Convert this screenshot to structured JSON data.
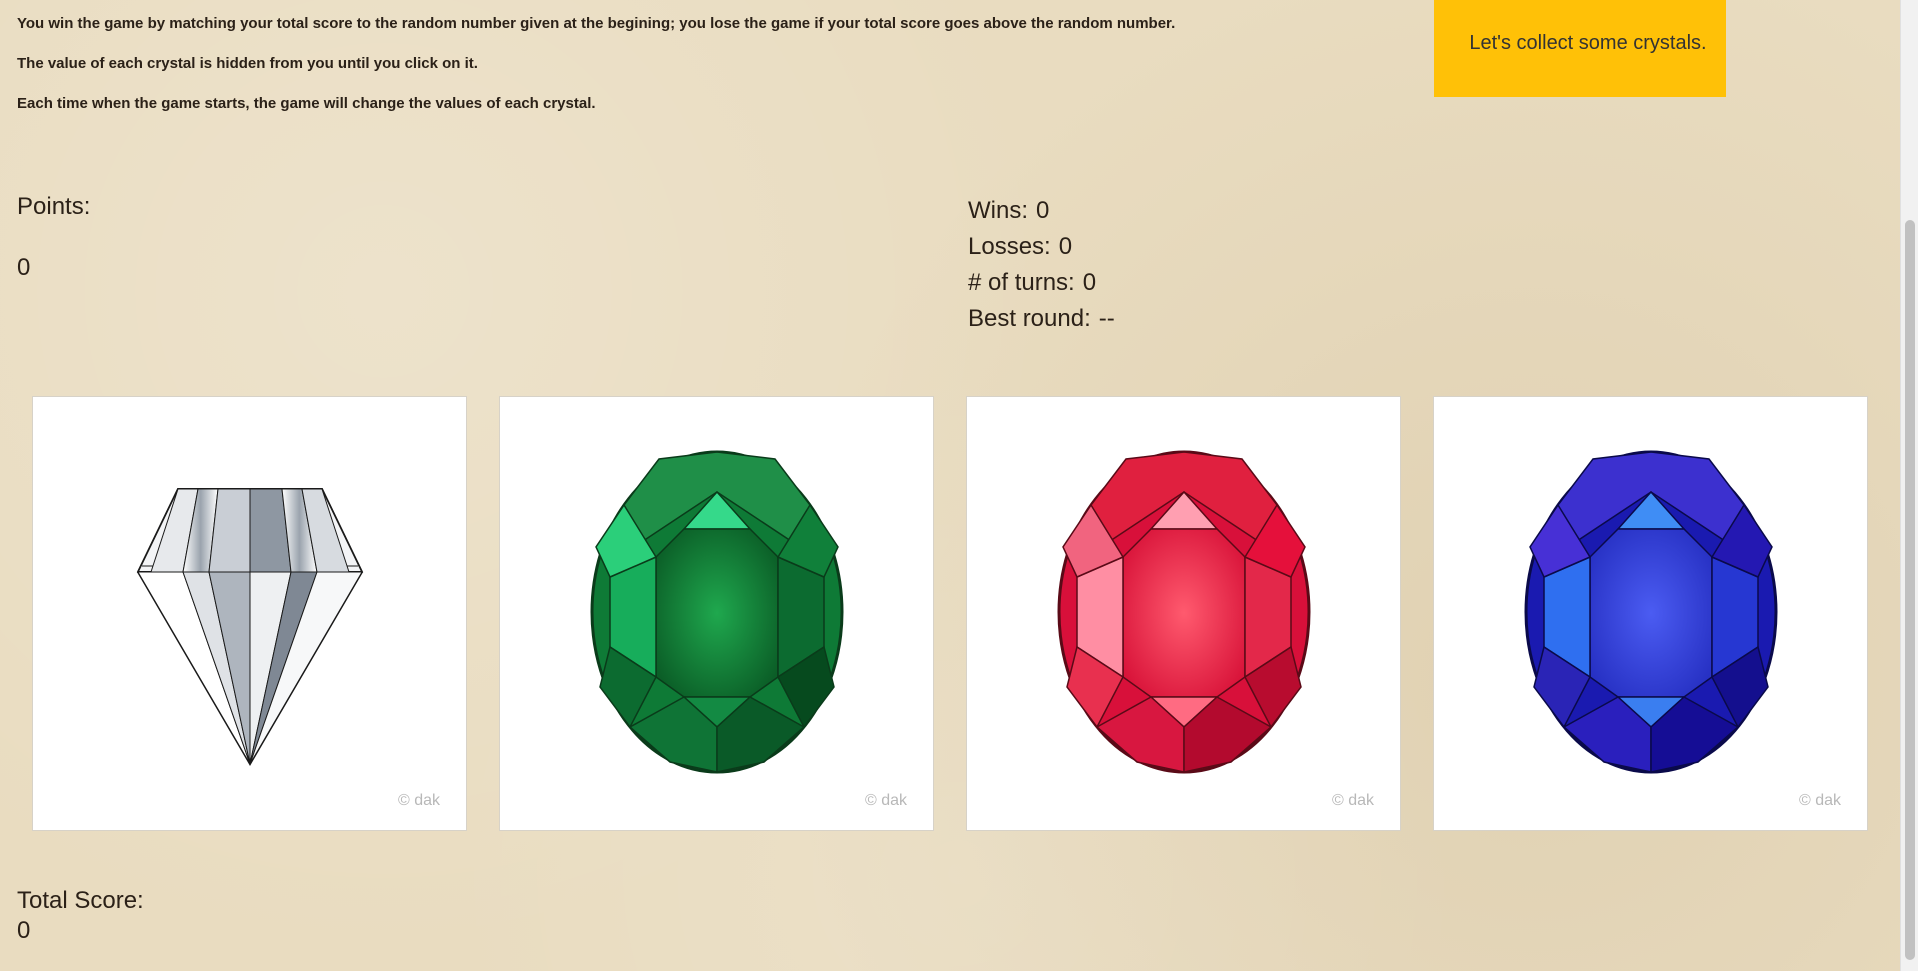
{
  "instructions": {
    "line1": "You win the game by matching your total score to the random number given at the begining; you lose the game if your total score goes above the random number.",
    "line2": "The value of each crystal is hidden from you until you click on it.",
    "line3": "Each time when the game starts, the game will change the values of each crystal."
  },
  "banner": {
    "text": "Let's collect some crystals.",
    "color": "#ffc107"
  },
  "points": {
    "label": "Points:",
    "value": "0"
  },
  "stats": {
    "wins_label": "Wins:",
    "wins": "0",
    "losses_label": "Losses:",
    "losses": "0",
    "turns_label": "# of turns:",
    "turns": "0",
    "best_label": "Best round:",
    "best": "--"
  },
  "crystals": [
    {
      "name": "diamond",
      "watermark": "© dak"
    },
    {
      "name": "emerald",
      "watermark": "© dak",
      "color": "#1a9e4a"
    },
    {
      "name": "ruby",
      "watermark": "© dak",
      "color": "#e8173e"
    },
    {
      "name": "sapphire",
      "watermark": "© dak",
      "color": "#2d2fd0"
    }
  ],
  "total": {
    "label": "Total Score:",
    "value": "0"
  }
}
